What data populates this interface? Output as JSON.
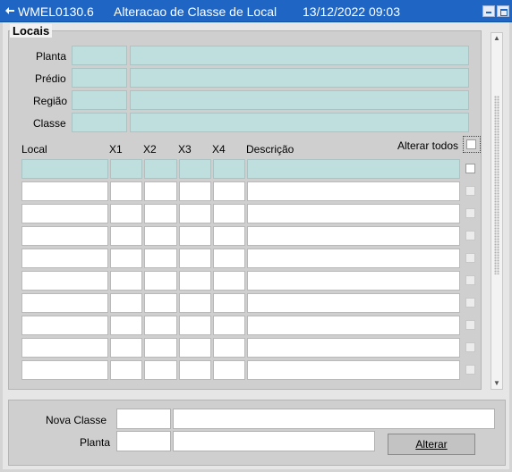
{
  "window": {
    "code": "WMEL0130.6",
    "title": "Alteracao de Classe de Local",
    "datetime": "13/12/2022 09:03",
    "minimize_icon": "minimize-icon",
    "maximize_icon": "maximize-icon"
  },
  "locais": {
    "section_title": "Locais",
    "labels": {
      "planta": "Planta",
      "predio": "Prédio",
      "regiao": "Região",
      "classe": "Classe"
    },
    "fields": {
      "planta_code": "",
      "planta_desc": "",
      "predio_code": "",
      "predio_desc": "",
      "regiao_code": "",
      "regiao_desc": "",
      "classe_code": "",
      "classe_desc": ""
    }
  },
  "grid": {
    "headers": {
      "local": "Local",
      "x1": "X1",
      "x2": "X2",
      "x3": "X3",
      "x4": "X4",
      "descricao": "Descrição",
      "alterar_todos": "Alterar todos"
    },
    "rows": [
      {
        "local": "",
        "x1": "",
        "x2": "",
        "x3": "",
        "x4": "",
        "descricao": "",
        "checked": false
      },
      {
        "local": "",
        "x1": "",
        "x2": "",
        "x3": "",
        "x4": "",
        "descricao": "",
        "checked": false
      },
      {
        "local": "",
        "x1": "",
        "x2": "",
        "x3": "",
        "x4": "",
        "descricao": "",
        "checked": false
      },
      {
        "local": "",
        "x1": "",
        "x2": "",
        "x3": "",
        "x4": "",
        "descricao": "",
        "checked": false
      },
      {
        "local": "",
        "x1": "",
        "x2": "",
        "x3": "",
        "x4": "",
        "descricao": "",
        "checked": false
      },
      {
        "local": "",
        "x1": "",
        "x2": "",
        "x3": "",
        "x4": "",
        "descricao": "",
        "checked": false
      },
      {
        "local": "",
        "x1": "",
        "x2": "",
        "x3": "",
        "x4": "",
        "descricao": "",
        "checked": false
      },
      {
        "local": "",
        "x1": "",
        "x2": "",
        "x3": "",
        "x4": "",
        "descricao": "",
        "checked": false
      },
      {
        "local": "",
        "x1": "",
        "x2": "",
        "x3": "",
        "x4": "",
        "descricao": "",
        "checked": false
      },
      {
        "local": "",
        "x1": "",
        "x2": "",
        "x3": "",
        "x4": "",
        "descricao": "",
        "checked": false
      }
    ]
  },
  "bottom": {
    "nova_classe_label": "Nova Classe",
    "planta_label": "Planta",
    "nova_classe_code": "",
    "nova_classe_desc": "",
    "planta_code": "",
    "planta_desc": "",
    "alterar_button": "Alterar"
  },
  "colors": {
    "titlebar": "#1f66c4",
    "active_field": "#bfdfdf",
    "panel": "#cfcfcf"
  }
}
